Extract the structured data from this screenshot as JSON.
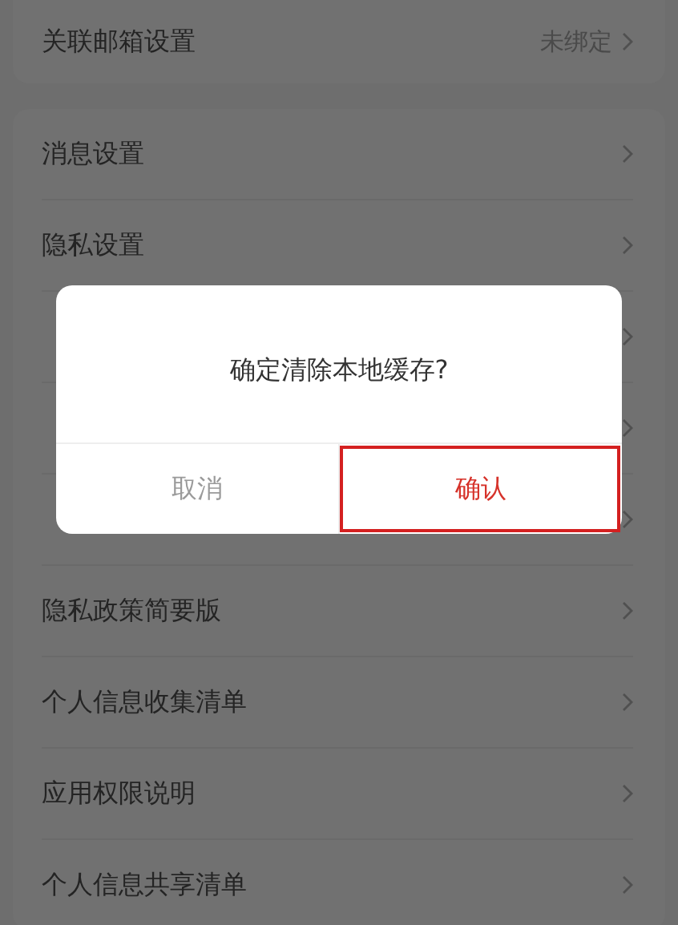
{
  "email_row": {
    "label": "关联邮箱设置",
    "value": "未绑定"
  },
  "menu_items": [
    {
      "kind": "row",
      "label": "消息设置"
    },
    {
      "kind": "row",
      "label": "隐私设置"
    },
    {
      "kind": "covered"
    },
    {
      "kind": "covered"
    },
    {
      "kind": "covered"
    },
    {
      "kind": "row",
      "label": "隐私政策简要版"
    },
    {
      "kind": "row",
      "label": "个人信息收集清单"
    },
    {
      "kind": "row",
      "label": "应用权限说明"
    },
    {
      "kind": "row",
      "label": "个人信息共享清单"
    }
  ],
  "dialog": {
    "message": "确定清除本地缓存?",
    "buttons": [
      {
        "kind": "cancel",
        "label": "取消",
        "highlighted": false
      },
      {
        "kind": "confirm",
        "label": "确认",
        "highlighted": true
      }
    ]
  }
}
